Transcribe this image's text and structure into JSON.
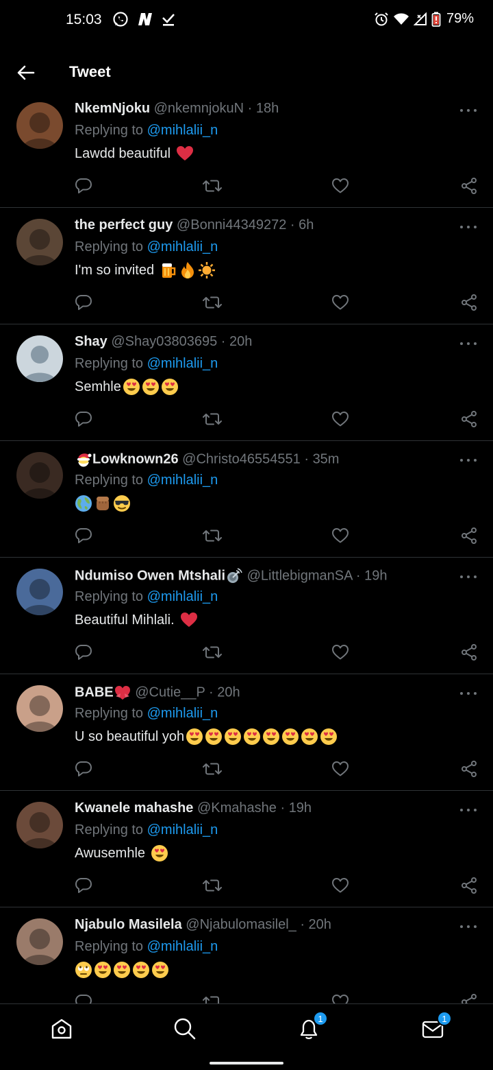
{
  "status_bar": {
    "time": "15:03",
    "battery": "79%"
  },
  "header": {
    "title": "Tweet"
  },
  "colors": {
    "accent": "#1d9bf0",
    "muted": "#71767b",
    "background": "#000000",
    "heart": "#e0245e"
  },
  "tweets": [
    {
      "name": "NkemNjoku",
      "handle": "@nkemnjokuN",
      "time": "18h",
      "reply_prefix": "Replying to",
      "reply_to": "@mihlalii_n",
      "text": "Lawdd beautiful",
      "emojis": [
        "red-heart"
      ],
      "avatar_color": "#7a4a2e"
    },
    {
      "name": "the perfect guy",
      "handle": "@Bonni44349272",
      "time": "6h",
      "reply_prefix": "Replying to",
      "reply_to": "@mihlalii_n",
      "text": "I'm so invited",
      "emojis": [
        "beer-mug",
        "fire",
        "sun"
      ],
      "avatar_color": "#5b4636"
    },
    {
      "name": "Shay",
      "handle": "@Shay03803695",
      "time": "20h",
      "reply_prefix": "Replying to",
      "reply_to": "@mihlalii_n",
      "text": "Semhle",
      "emojis": [
        "heart-eyes",
        "heart-eyes",
        "heart-eyes"
      ],
      "avatar_color": "#ccd6dd"
    },
    {
      "name": "Lowknown26",
      "name_prefix_emoji": "santa",
      "handle": "@Christo46554551",
      "time": "35m",
      "reply_prefix": "Replying to",
      "reply_to": "@mihlalii_n",
      "text": "",
      "emojis": [
        "globe",
        "raised-fist",
        "sunglasses"
      ],
      "avatar_color": "#3a2a22"
    },
    {
      "name": "Ndumiso Owen Mtshali",
      "name_suffix_emoji": "satellite",
      "handle": "@LittlebigmanSA",
      "time": "19h",
      "reply_prefix": "Replying to",
      "reply_to": "@mihlalii_n",
      "text": "Beautiful Mihlali.",
      "emojis": [
        "red-heart"
      ],
      "avatar_color": "#4a6a9a"
    },
    {
      "name": "BABE",
      "name_suffix_emoji": "heart-ribbon",
      "handle": "@Cutie__P",
      "time": "20h",
      "reply_prefix": "Replying to",
      "reply_to": "@mihlalii_n",
      "text": "U so beautiful yoh",
      "emojis": [
        "heart-eyes",
        "heart-eyes",
        "heart-eyes",
        "heart-eyes",
        "heart-eyes",
        "heart-eyes",
        "heart-eyes",
        "heart-eyes"
      ],
      "avatar_color": "#c9a089"
    },
    {
      "name": "Kwanele mahashe",
      "handle": "@Kmahashe",
      "time": "19h",
      "reply_prefix": "Replying to",
      "reply_to": "@mihlalii_n",
      "text": "Awusemhle",
      "emojis": [
        "heart-eyes"
      ],
      "avatar_color": "#6b4a3a"
    },
    {
      "name": "Njabulo Masilela",
      "handle": "@Njabulomasilel_",
      "time": "20h",
      "reply_prefix": "Replying to",
      "reply_to": "@mihlalii_n",
      "text": "",
      "emojis": [
        "rolling-eyes",
        "heart-eyes",
        "heart-eyes",
        "heart-eyes",
        "heart-eyes"
      ],
      "avatar_color": "#9a7b6a"
    }
  ],
  "bottom_nav": {
    "items": [
      "home-icon",
      "search-icon",
      "notifications-icon",
      "messages-icon"
    ],
    "notifications_badge": "1",
    "messages_badge": "1"
  }
}
